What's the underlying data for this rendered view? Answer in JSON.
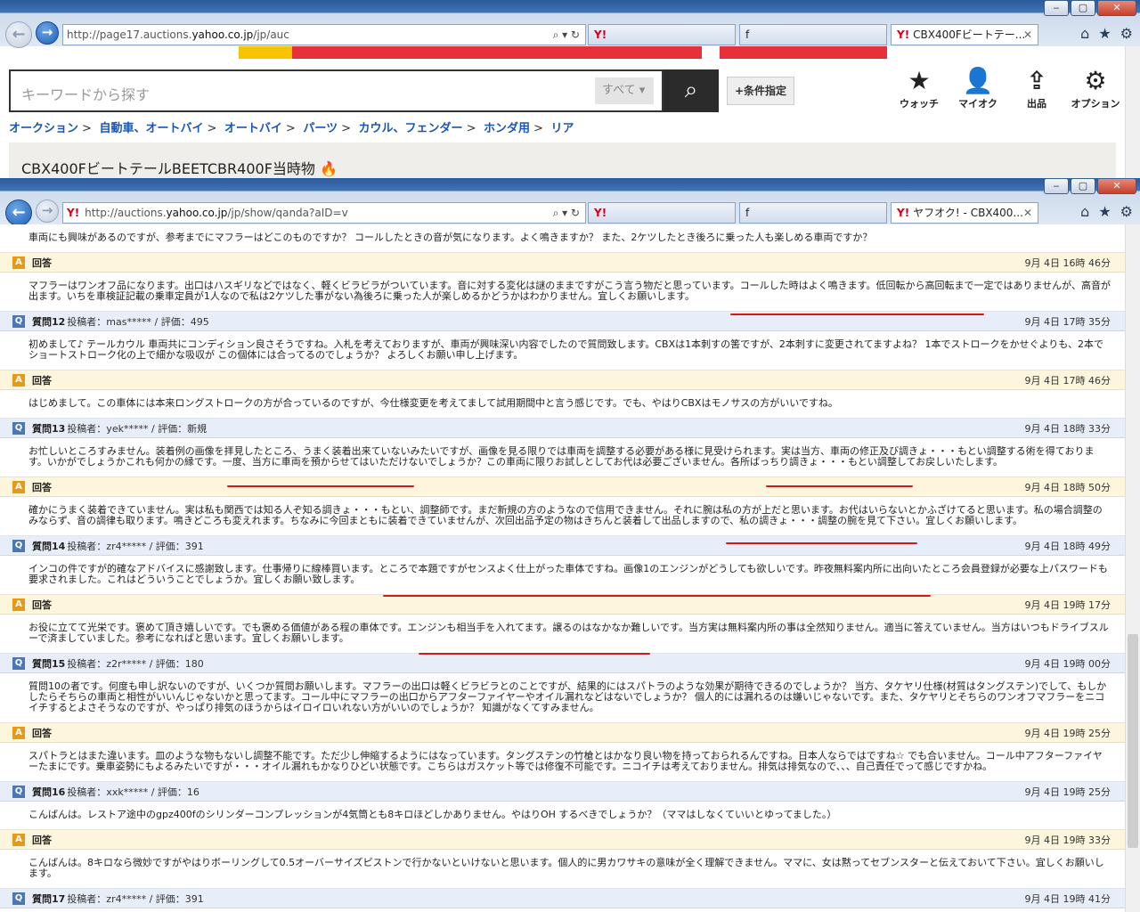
{
  "window1": {
    "url_prefix": "http://page17.auctions.",
    "url_domain": "yahoo.co.jp",
    "url_suffix": "/jp/auc",
    "tab_active": "CBX400Fビートテー...",
    "search": {
      "placeholder": "キーワードから探す",
      "scope": "すべて",
      "condition": "+条件指定"
    },
    "icons": [
      {
        "label": "ウォッチ",
        "icon": "star-icon"
      },
      {
        "label": "マイオク",
        "icon": "user-icon"
      },
      {
        "label": "出品",
        "icon": "upload-icon"
      },
      {
        "label": "オプション",
        "icon": "gear-icon"
      }
    ],
    "breadcrumb": [
      "オークション",
      "自動車、オートバイ",
      "オートバイ",
      "パーツ",
      "カウル、フェンダー",
      "ホンダ用",
      "リア"
    ],
    "item_title": "CBX400FビートテールBEETCBR400F当時物"
  },
  "window2": {
    "url_prefix": "http://auctions.",
    "url_domain": "yahoo.co.jp",
    "url_suffix": "/jp/show/qanda?aID=v",
    "tab_active": "ヤフオク! - CBX400...",
    "tab_other_1": "Y!",
    "tab_other_2": "f"
  },
  "qa": [
    {
      "type": "body",
      "text": "車両にも興味があるのですが、参考までにマフラーはどこのものですか？ コールしたときの音が気になります。よく鳴きますか？ また、2ケツしたとき後ろに乗った人も楽しめる車両ですか？"
    },
    {
      "type": "a",
      "label": "回答",
      "date": "9月 4日 16時 46分"
    },
    {
      "type": "body",
      "text": "マフラーはワンオフ品になります。出口はハスギリなどではなく、軽くビラビラがついています。音に対する変化は謎のままですがこう言う物だと思っています。コールした時はよく鳴きます。低回転から高回転まで一定ではありませんが、高音が出ます。いちを車検証記載の乗車定員が1人なので私は2ケツした事がない為後ろに乗った人が楽しめるかどうかはわかりません。宜しくお願いします。"
    },
    {
      "type": "q",
      "label": "質問12",
      "meta": "投稿者：mas***** / 評価：495",
      "date": "9月 4日 17時 35分"
    },
    {
      "type": "body",
      "text": "初めまして♪ テールカウル 車両共にコンディション良さそうですね。入札を考えておりますが、車両が興味深い内容でしたので質問致します。CBXは1本刺すの筈ですが、2本刺すに変更されてますよね？ 1本でストロークをかせぐよりも、2本でショートストローク化の上で細かな吸収が この個体には合ってるのでしょうか？ よろしくお願い申し上げます。"
    },
    {
      "type": "a",
      "label": "回答",
      "date": "9月 4日 17時 46分"
    },
    {
      "type": "body",
      "text": "はじめまして。この車体には本来ロングストロークの方が合っているのですが、今仕様変更を考えてまして試用期間中と言う感じです。でも、やはりCBXはモノサスの方がいいですね。"
    },
    {
      "type": "q",
      "label": "質問13",
      "meta": "投稿者：yek***** / 評価：新規",
      "date": "9月 4日 18時 33分"
    },
    {
      "type": "body",
      "text": "お忙しいところすみません。装着例の画像を拝見したところ、うまく装着出来ていないみたいですが、画像を見る限りでは車両を調整する必要がある様に見受けられます。実は当方、車両の修正及び調きょ・・・もとい調整する術を得ております。いかがでしょうかこれも何かの縁です。一度、当方に車両を預からせてはいただけないでしょうか？この車両に限りお試しとしてお代は必要ございません。各所ばっちり調きょ・・・もとい調整してお戻しいたします。"
    },
    {
      "type": "a",
      "label": "回答",
      "date": "9月 4日 18時 50分"
    },
    {
      "type": "body",
      "text": "確かにうまく装着できていません。実は私も関西では知る人ぞ知る調きょ・・・もとい、調整師です。まだ新規の方のようなので信用できません。それに腕は私の方が上だと思います。お代はいらないとかふざけてると思います。私の場合調整のみならず、音の調律も取ります。鳴きどころも変えれます。ちなみに今回まともに装着できていませんが、次回出品予定の物はきちんと装着して出品しますので、私の調きょ・・・調整の腕を見て下さい。宜しくお願いします。"
    },
    {
      "type": "q",
      "label": "質問14",
      "meta": "投稿者：zr4***** / 評価：391",
      "date": "9月 4日 18時 49分"
    },
    {
      "type": "body",
      "text": "インコの件ですが的確なアドバイスに感謝致します。仕事帰りに線棒買います。ところで本題ですがセンスよく仕上がった車体ですね。画像1のエンジンがどうしても欲しいです。昨夜無料案内所に出向いたところ会員登録が必要な上パスワードも要求されました。これはどういうことでしょうか。宜しくお願い致します。"
    },
    {
      "type": "a",
      "label": "回答",
      "date": "9月 4日 19時 17分"
    },
    {
      "type": "body",
      "text": "お役に立てて光栄です。褒めて頂き嬉しいです。でも褒める価値がある程の車体です。エンジンも相当手を入れてます。譲るのはなかなか難しいです。当方実は無料案内所の事は全然知りません。適当に答えていません。当方はいつもドライブスルーで済ましていました。参考になればと思います。宜しくお願いします。"
    },
    {
      "type": "q",
      "label": "質問15",
      "meta": "投稿者：z2r***** / 評価：180",
      "date": "9月 4日 19時 00分"
    },
    {
      "type": "body",
      "text": "質問10の者です。何度も申し訳ないのですが、いくつか質問お願いします。マフラーの出口は軽くビラビラとのことですが、結果的にはスパトラのような効果が期待できるのでしょうか？ 当方、タケヤリ仕様(材質はタングステン)でして、もしかしたらそちらの車両と相性がいいんじゃないかと思ってます。コール中にマフラーの出口からアフターファイヤーやオイル漏れなどはないでしょうか？ 個人的には漏れるのは嫌いじゃないです。また、タケヤリとそちらのワンオフマフラーをニコイチするとよさそうなのですが、やっぱり排気のほうからはイロイロいれない方がいいのでしょうか？ 知識がなくてすみません。"
    },
    {
      "type": "a",
      "label": "回答",
      "date": "9月 4日 19時 25分"
    },
    {
      "type": "body",
      "text": "スパトラとはまた違います。皿のような物もないし調整不能です。ただ少し伸縮するようにはなっています。タングステンの竹槍とはかなり良い物を持っておられるんですね。日本人ならではですね☆ でも合いません。コール中アフターファイヤーたまにです。乗車姿勢にもよるみたいですが・・・オイル漏れもかなりひどい状態です。こちらはガスケット等では修復不可能です。ニコイチは考えておりません。排気は排気なので、、、自己責任でって感じですかね。"
    },
    {
      "type": "q",
      "label": "質問16",
      "meta": "投稿者：xxk***** / 評価：16",
      "date": "9月 4日 19時 25分"
    },
    {
      "type": "body",
      "text": "こんばんは。レストア途中のgpz400fのシリンダーコンプレッションが4気筒とも8キロほどしかありません。やはりOH するべきでしょうか？（ママはしなくていいとゆってました。）"
    },
    {
      "type": "a",
      "label": "回答",
      "date": "9月 4日 19時 33分"
    },
    {
      "type": "body",
      "text": "こんばんは。8キロなら微妙ですがやはりボーリングして0.5オーバーサイズピストンで行かないといけないと思います。個人的に男カワサキの意味が全く理解できません。ママに、女は黙ってセブンスターと伝えておいて下さい。宜しくお願いします。"
    },
    {
      "type": "q",
      "label": "質問17",
      "meta": "投稿者：zr4***** / 評価：391",
      "date": "9月 4日 19時 41分"
    }
  ]
}
